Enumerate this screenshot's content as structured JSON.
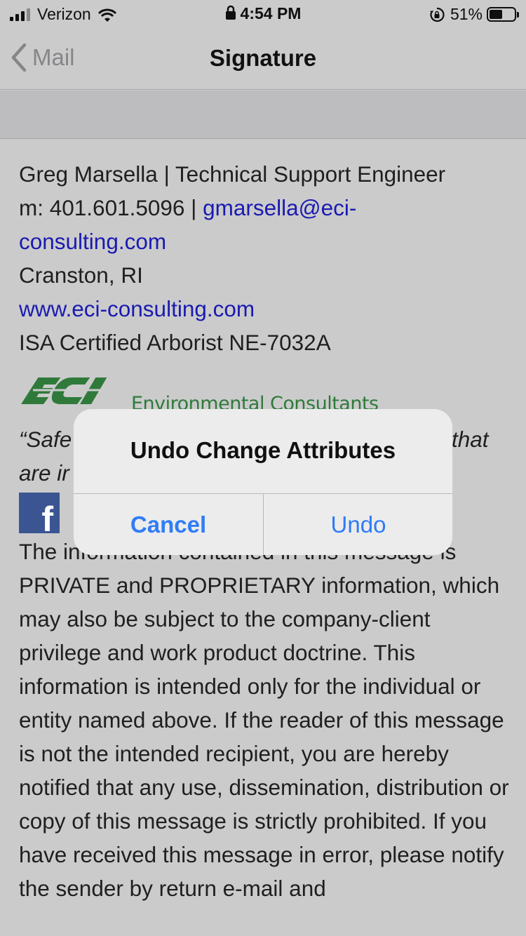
{
  "status_bar": {
    "carrier": "Verizon",
    "time": "4:54 PM",
    "battery": "51%",
    "battery_level": 0.51,
    "icons": [
      "signal-icon",
      "wifi-icon",
      "lock-icon",
      "rotation-lock-icon",
      "battery-icon"
    ]
  },
  "nav": {
    "back_label": "Mail",
    "title": "Signature"
  },
  "signature": {
    "line1": "Greg Marsella | Technical Support Engineer",
    "phone_prefix": "m: 401.601.5096 | ",
    "email": "gmarsella@eci-consulting.com",
    "email_part1": "gmarsella@eci-",
    "email_part2": "consulting.com",
    "location": "Cranston, RI",
    "website": "www.eci-consulting.com",
    "cert": "ISA Certified Arborist NE-7032A",
    "logo_caption": "Environmental Consultants",
    "logo_brand": "ECI",
    "quote_left1": "“Safe",
    "quote_right1": "that",
    "quote_left2": "are ir",
    "fb_letter": "f",
    "disclaimer": "The information contained in this message is PRIVATE and PROPRIETARY information, which may also be subject to the company-client privilege and work product doctrine. This information is intended only for the individual or entity named above. If the reader of this message is not the intended recipient, you are hereby notified that any use, dissemination, distribution or copy of this message is strictly prohibited. If you have received this message in error, please notify the sender by return e-mail and"
  },
  "alert": {
    "title": "Undo Change Attributes",
    "cancel_label": "Cancel",
    "undo_label": "Undo"
  },
  "colors": {
    "link": "#1a1ab0",
    "alert_button": "#2f7cf6",
    "logo_green": "#2f7a3a",
    "facebook": "#3b5592"
  }
}
